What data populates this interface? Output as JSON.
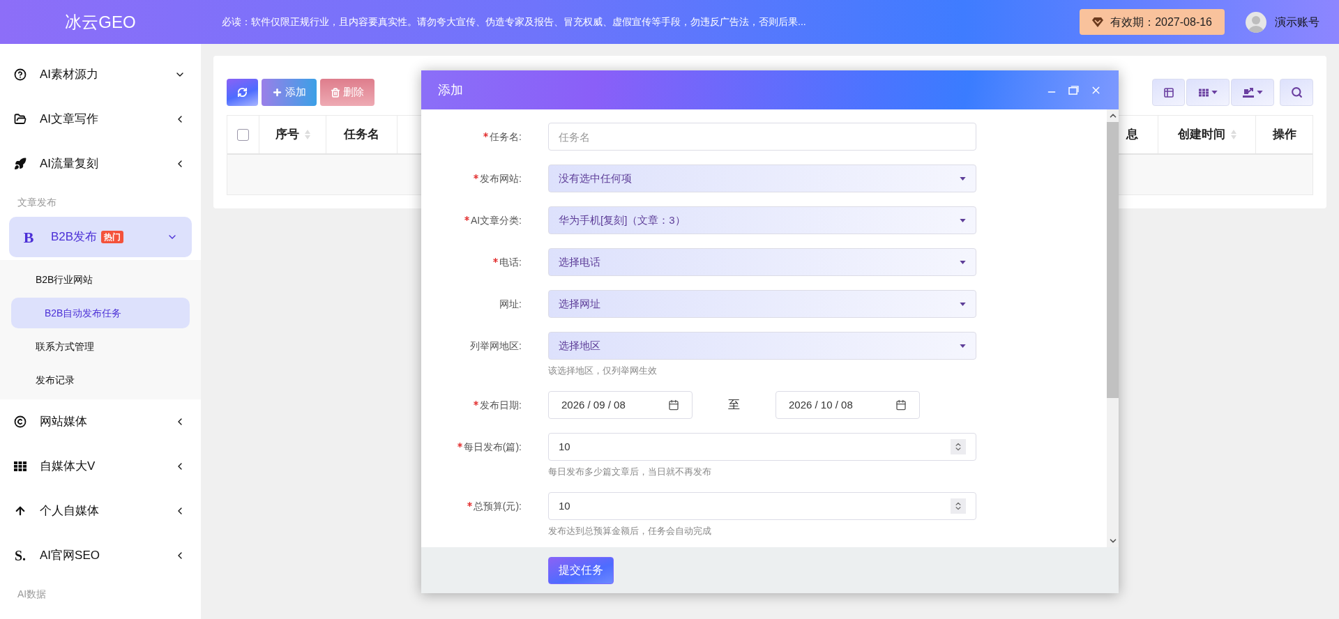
{
  "header": {
    "logo": "冰云GEO",
    "notice": "必读：软件仅限正规行业，且内容要真实性。请勿夸大宣传、伪造专家及报告、冒充权威、虚假宣传等手段，勿违反广告法，否则后果...",
    "expiry": "有效期：2027-08-16",
    "user": "演示账号"
  },
  "sidebar": {
    "items": [
      {
        "kind": "menu",
        "label": "AI素材源力",
        "expanded": true,
        "selected": false
      },
      {
        "kind": "menu",
        "label": "AI文章写作",
        "expanded": false,
        "selected": false
      },
      {
        "kind": "menu",
        "label": "AI流量复刻",
        "expanded": false,
        "selected": false
      },
      {
        "kind": "section",
        "label": "文章发布"
      },
      {
        "kind": "menu",
        "label": "B2B发布",
        "glyph": "B",
        "badge": "热门",
        "expanded": true,
        "selected": true,
        "children": [
          {
            "label": "B2B行业网站",
            "selected": false
          },
          {
            "label": "B2B自动发布任务",
            "selected": true
          },
          {
            "label": "联系方式管理",
            "selected": false
          },
          {
            "label": "发布记录",
            "selected": false
          }
        ]
      },
      {
        "kind": "menu",
        "label": "网站媒体",
        "expanded": false,
        "selected": false
      },
      {
        "kind": "menu",
        "label": "自媒体大V",
        "expanded": false,
        "selected": false
      },
      {
        "kind": "menu",
        "label": "个人自媒体",
        "expanded": false,
        "selected": false
      },
      {
        "kind": "menu",
        "label": "AI官网SEO",
        "glyph": "S.",
        "expanded": false,
        "selected": false
      },
      {
        "kind": "section",
        "label": "AI数据"
      }
    ]
  },
  "toolbar": {
    "buttons": [
      {
        "kind": "refresh"
      },
      {
        "kind": "add",
        "label": "添加"
      },
      {
        "kind": "delete",
        "label": "删除"
      }
    ],
    "right_buttons": [
      {
        "kind": "view"
      },
      {
        "kind": "columns"
      },
      {
        "kind": "export"
      },
      {
        "kind": "search"
      }
    ]
  },
  "table": {
    "select_all": {
      "checked": false
    },
    "columns": [
      {
        "label": "序号",
        "sortable": true
      },
      {
        "label": "任务名",
        "sortable": false
      },
      {
        "label": "息",
        "sortable": false
      },
      {
        "label": "创建时间",
        "sortable": true
      },
      {
        "label": "操作",
        "sortable": false
      }
    ]
  },
  "modal": {
    "title": "添加",
    "submit": "提交任务",
    "fields": [
      {
        "kind": "text",
        "label": "任务名:",
        "required": true,
        "placeholder": "任务名"
      },
      {
        "kind": "select",
        "label": "发布网站:",
        "required": true,
        "value": "没有选中任何项"
      },
      {
        "kind": "select",
        "label": "AI文章分类:",
        "required": true,
        "value": "华为手机[复刻]（文章：3）"
      },
      {
        "kind": "select",
        "label": "电话:",
        "required": true,
        "value": "选择电话"
      },
      {
        "kind": "select",
        "label": "网址:",
        "required": false,
        "value": "选择网址"
      },
      {
        "kind": "select",
        "label": "列举网地区:",
        "required": false,
        "value": "选择地区",
        "hint": "该选择地区，仅列举网生效"
      },
      {
        "kind": "date_range",
        "label": "发布日期:",
        "required": true,
        "start": "2026 / 09 / 08",
        "separator": "至",
        "end": "2026 / 10 / 08"
      },
      {
        "kind": "number",
        "label": "每日发布(篇):",
        "required": true,
        "value": "10",
        "hint": "每日发布多少篇文章后，当日就不再发布"
      },
      {
        "kind": "number",
        "label": "总预算(元):",
        "required": true,
        "value": "10",
        "hint": "发布达到总预算金额后，任务会自动完成"
      }
    ]
  }
}
